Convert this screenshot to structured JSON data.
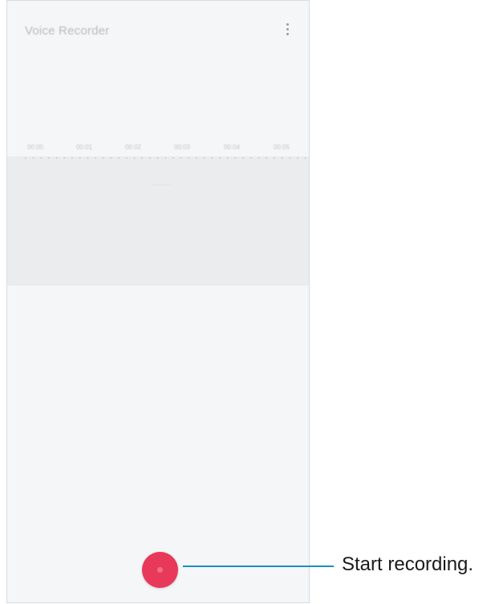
{
  "app": {
    "title": "Voice Recorder"
  },
  "menu": {
    "icon": "more-vertical-icon"
  },
  "timeline": {
    "labels": [
      "00:00",
      "00:01",
      "00:02",
      "00:03",
      "00:04",
      "00:05"
    ]
  },
  "record": {
    "icon": "record-icon",
    "color": "#e8395a"
  },
  "callout": {
    "text": "Start recording.",
    "line_color": "#1d8fb8"
  }
}
